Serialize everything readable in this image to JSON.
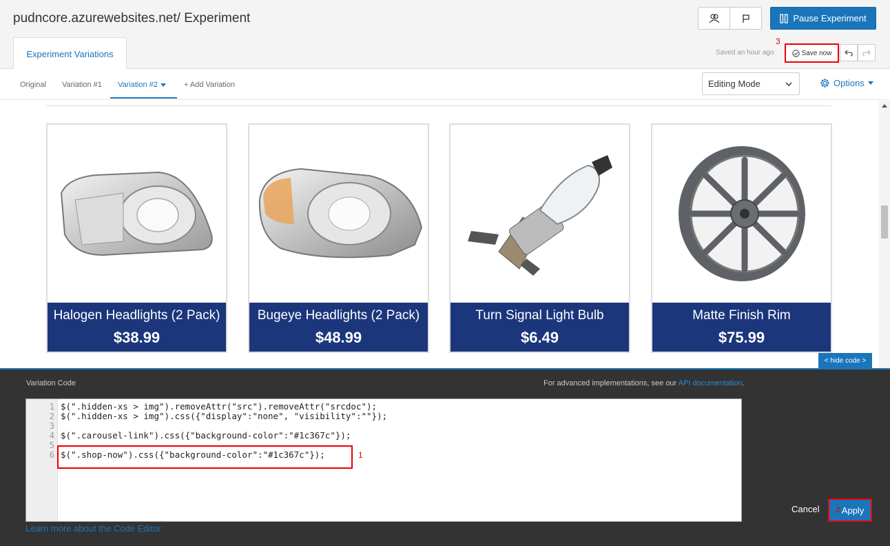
{
  "header": {
    "title": "pudncore.azurewebsites.net/ Experiment",
    "pause_label": "Pause Experiment",
    "tab_label": "Experiment Variations",
    "saved_text": "Saved an hour ago",
    "save_now_label": "Save now",
    "annotation_3": "3"
  },
  "variations": {
    "tabs": [
      {
        "label": "Original"
      },
      {
        "label": "Variation #1"
      },
      {
        "label": "Variation #2"
      },
      {
        "label": "+ Add Variation"
      }
    ],
    "mode": "Editing Mode",
    "options_label": "Options"
  },
  "products": [
    {
      "name": "Halogen Headlights (2 Pack)",
      "price": "$38.99"
    },
    {
      "name": "Bugeye Headlights (2 Pack)",
      "price": "$48.99"
    },
    {
      "name": "Turn Signal Light Bulb",
      "price": "$6.49"
    },
    {
      "name": "Matte Finish Rim",
      "price": "$75.99"
    }
  ],
  "hide_code_label": "< hide code >",
  "code_panel": {
    "label": "Variation Code",
    "adv_text": "For advanced implementations, see our ",
    "adv_link": "API documentation",
    "adv_suffix": ".",
    "line_numbers": [
      "1",
      "2",
      "3",
      "4",
      "5",
      "6"
    ],
    "lines": [
      "$(\".hidden-xs > img\").removeAttr(\"src\").removeAttr(\"srcdoc\");",
      "$(\".hidden-xs > img\").css({\"display\":\"none\", \"visibility\":\"\"});",
      "",
      "$(\".carousel-link\").css({\"background-color\":\"#1c367c\"});",
      "",
      "$(\".shop-now\").css({\"background-color\":\"#1c367c\"});"
    ],
    "annotation_1": "1",
    "annotation_2": "2",
    "learn_more": "Learn more about the Code Editor",
    "cancel_label": "Cancel",
    "apply_label": "Apply"
  },
  "colors": {
    "accent": "#1a75bb",
    "product_banner": "#1c367c",
    "annotation": "#e00000"
  }
}
